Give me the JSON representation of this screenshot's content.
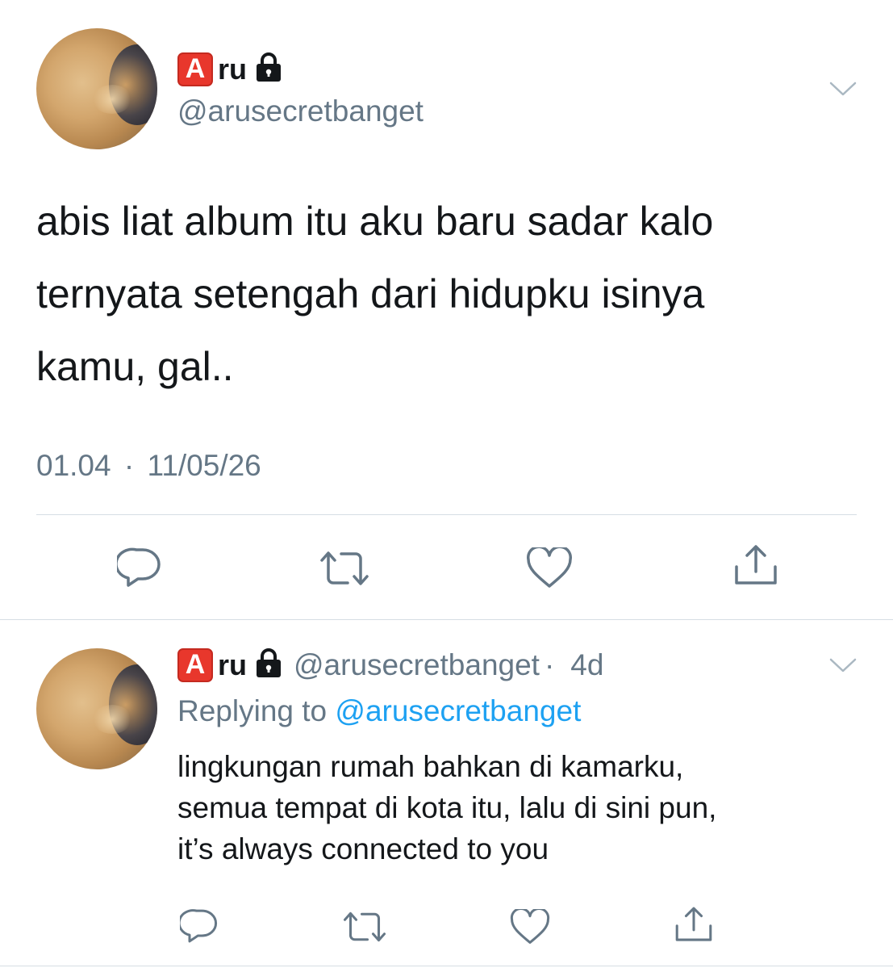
{
  "main_tweet": {
    "display_name": "ru",
    "badge_letter": "A",
    "handle": "@arusecretbanget",
    "text_lines": [
      "abis liat album itu aku baru sadar kalo",
      "ternyata setengah dari hidupku isinya",
      "kamu, gal.."
    ],
    "time": "01.04",
    "separator": "·",
    "date": "11/05/26",
    "actions": [
      "reply-icon",
      "retweet-icon",
      "like-icon",
      "share-icon"
    ]
  },
  "reply_tweet": {
    "display_name": "ru",
    "badge_letter": "A",
    "handle": "@arusecretbanget",
    "separator": "·",
    "age": "4d",
    "replying_prefix": "Replying to",
    "replying_to": "@arusecretbanget",
    "text_lines": [
      "lingkungan rumah bahkan di kamarku,",
      "semua tempat di kota itu, lalu di sini pun,",
      "it’s always connected to you"
    ],
    "actions": [
      "reply-icon",
      "retweet-icon",
      "like-icon",
      "share-icon"
    ]
  },
  "colors": {
    "text": "#14171a",
    "secondary": "#657786",
    "link": "#1da1f2",
    "divider": "#d6dee4",
    "badge_red": "#e8372c"
  }
}
